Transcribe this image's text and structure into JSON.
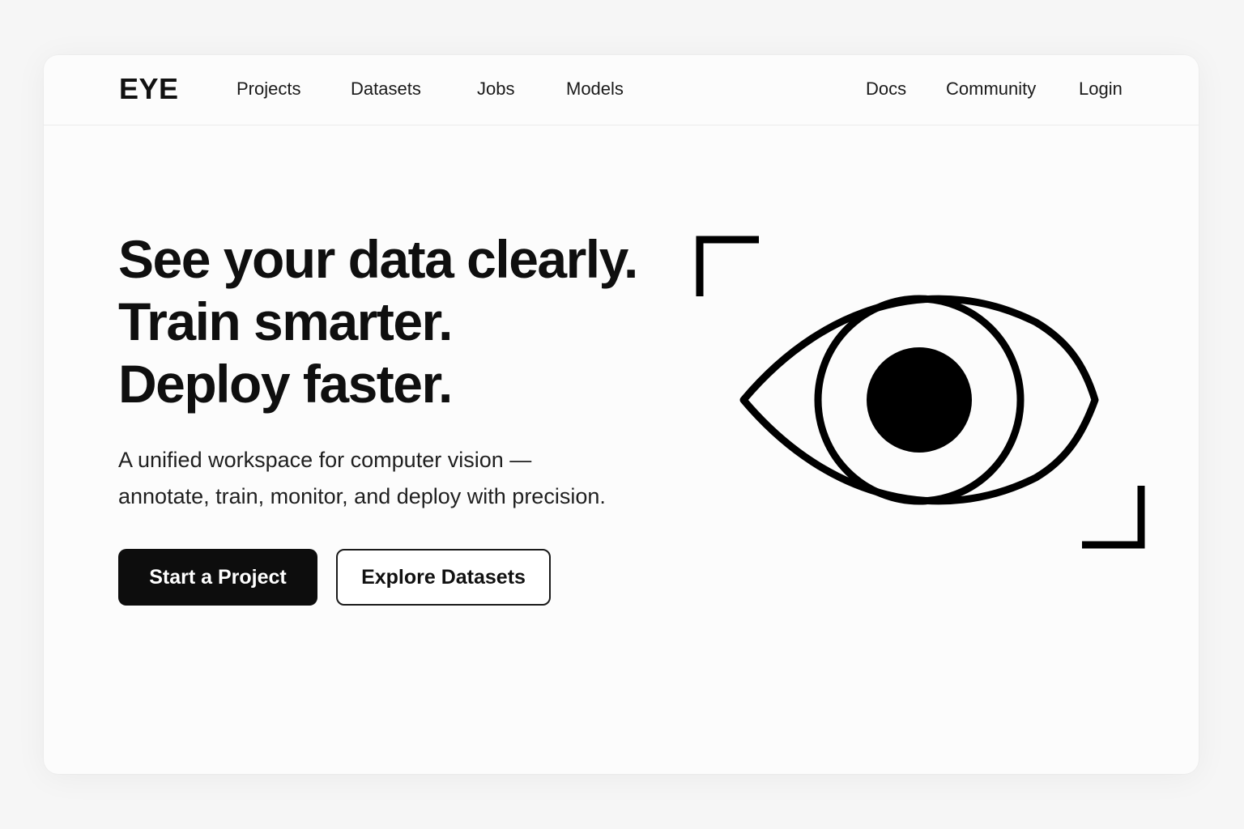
{
  "brand": {
    "logo": "EYE"
  },
  "nav": {
    "left": [
      {
        "label": "Projects"
      },
      {
        "label": "Datasets"
      },
      {
        "label": "Jobs"
      },
      {
        "label": "Models"
      }
    ],
    "right": [
      {
        "label": "Docs"
      },
      {
        "label": "Community"
      },
      {
        "label": "Login"
      }
    ]
  },
  "hero": {
    "title_lines": [
      "See your data clearly.",
      "Train smarter.",
      "Deploy faster."
    ],
    "subtitle_lines": [
      "A unified workspace for computer vision —",
      "annotate, train, monitor, and deploy with precision."
    ],
    "primary_cta": "Start a Project",
    "secondary_cta": "Explore Datasets"
  },
  "illustration": {
    "icon": "eye-icon",
    "frame": "viewfinder-corners",
    "color": "#000000"
  },
  "colors": {
    "background": "#f6f6f6",
    "surface": "#fcfcfc",
    "primary": "#0d0d0d",
    "text": "#111111"
  }
}
